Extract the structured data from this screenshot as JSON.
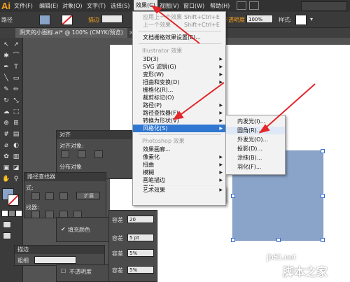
{
  "app": {
    "logo": "Ai"
  },
  "menubar": {
    "items": [
      "文件(F)",
      "编辑(E)",
      "对象(O)",
      "文字(T)",
      "选择(S)",
      "效果(C)",
      "视图(V)",
      "窗口(W)",
      "帮助(H)"
    ],
    "active_index": 5
  },
  "controlbar": {
    "path_label": "路径",
    "stroke_label": "描边",
    "opacity_label": "不透明度",
    "opacity_value": "100%",
    "style_label": "样式:",
    "basic_label": "基本"
  },
  "doc_tab": {
    "title": "阴天的小图标.ai* @ 100% (CMYK/预览)"
  },
  "effect_menu": {
    "items": [
      {
        "label": "应用上一个效果",
        "shortcut": "Shift+Ctrl+E",
        "dim": true
      },
      {
        "label": "上一个效果",
        "shortcut": "Shift+Ctrl+E",
        "dim": true
      },
      {
        "label": "文档栅格效果设置(E)..."
      }
    ],
    "illustrator_section": "Illustrator 效果",
    "illustrator_items": [
      {
        "label": "3D(3)"
      },
      {
        "label": "SVG 滤镜(G)"
      },
      {
        "label": "变形(W)"
      },
      {
        "label": "扭曲和变换(D)"
      },
      {
        "label": "栅格化(R)..."
      },
      {
        "label": "裁剪标记(O)"
      },
      {
        "label": "路径(P)"
      },
      {
        "label": "路径查找器(F)"
      },
      {
        "label": "转换为形状(V)"
      },
      {
        "label": "风格化(S)",
        "highlighted": true
      }
    ],
    "photoshop_section": "Photoshop 效果",
    "photoshop_items": [
      {
        "label": "效果画廊..."
      },
      {
        "label": "像素化"
      },
      {
        "label": "扭曲"
      },
      {
        "label": "模糊"
      },
      {
        "label": "画笔描边"
      },
      {
        "label": "素描"
      },
      {
        "label": "纹理"
      },
      {
        "label": "艺术效果"
      },
      {
        "label": "视频"
      },
      {
        "label": "风格化"
      }
    ]
  },
  "stylize_submenu": {
    "items": [
      {
        "label": "内发光(I)..."
      },
      {
        "label": "圆角(R)...",
        "highlighted": true
      },
      {
        "label": "外发光(O)..."
      },
      {
        "label": "投影(D)..."
      },
      {
        "label": "涂抹(B)..."
      },
      {
        "label": "羽化(F)..."
      }
    ]
  },
  "panels": {
    "align": {
      "title": "对齐",
      "align_objects": "对齐对象:",
      "distribute_objects": "分布对象"
    },
    "pathfinder": {
      "title": "路径查找器",
      "shape_modes": "式:",
      "expand": "扩展",
      "pathfinders": "找器:"
    },
    "appearance": {
      "fill_label": "填充颜色",
      "opacity_label": "容差",
      "opacity_value": "20"
    },
    "stroke": {
      "title": "描边",
      "weight_label": "粗细"
    },
    "transparency": {
      "label": "不透明度"
    },
    "tolerance_rows": [
      "容差",
      "容差",
      "容差",
      "容差"
    ],
    "tolerance_values": [
      "20",
      "5 pt",
      "5%",
      "5%"
    ]
  },
  "watermark": {
    "line1": "jb51.net",
    "line2": "脚本之家"
  },
  "colors": {
    "accent": "#2f77d1",
    "arrow": "#e3262a",
    "shape_fill": "#8aa4c9",
    "logo": "#f7a21b"
  }
}
